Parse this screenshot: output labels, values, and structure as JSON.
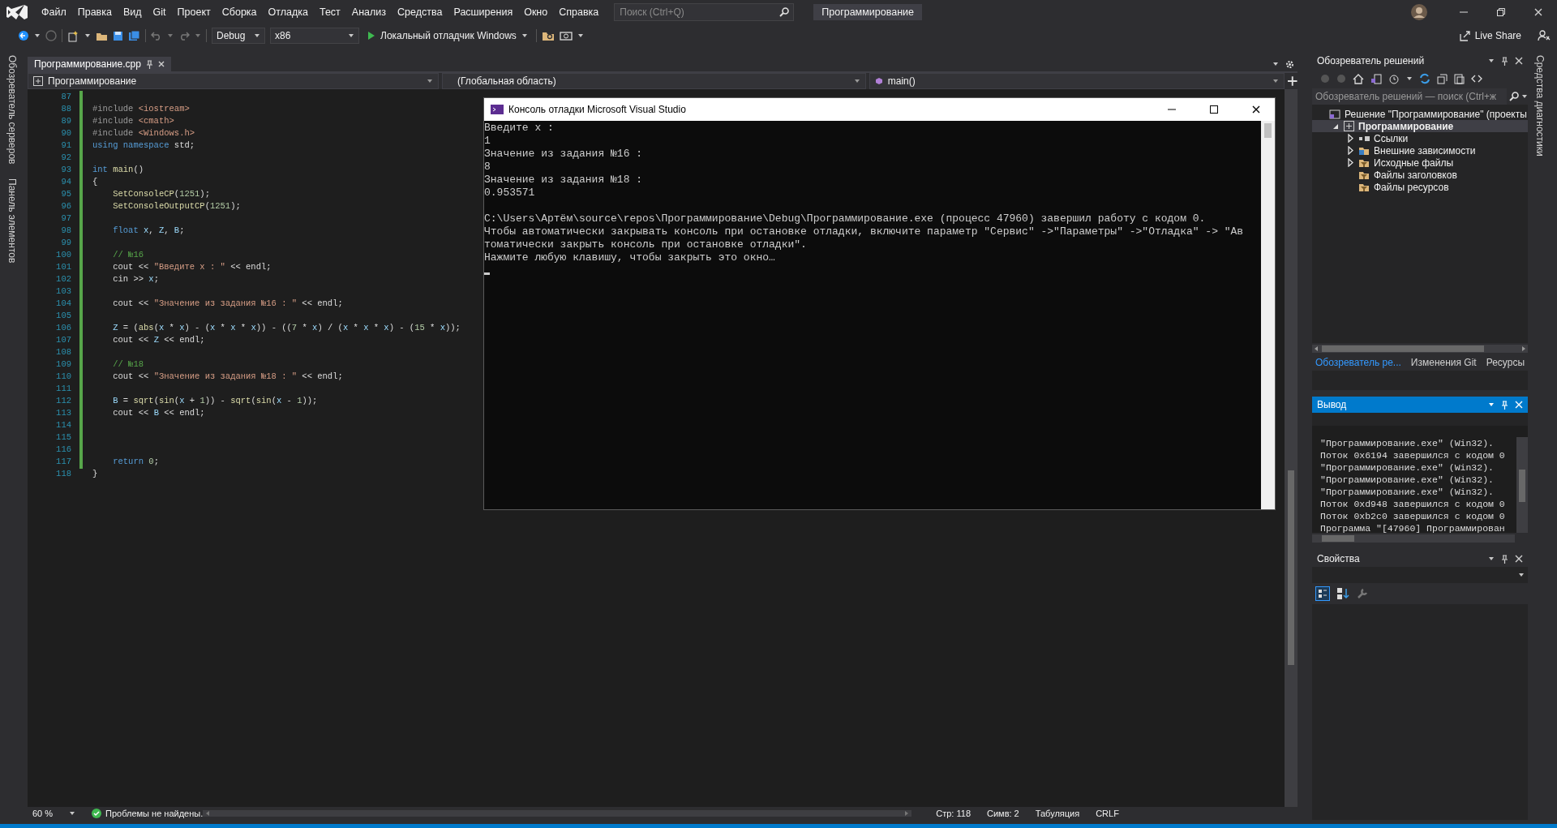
{
  "title_bar": {
    "menu": [
      "Файл",
      "Правка",
      "Вид",
      "Git",
      "Проект",
      "Сборка",
      "Отладка",
      "Тест",
      "Анализ",
      "Средства",
      "Расширения",
      "Окно",
      "Справка"
    ],
    "search": {
      "placeholder": "Поиск (Ctrl+Q)"
    },
    "solution_name": "Программирование"
  },
  "toolbar": {
    "configuration": "Debug",
    "platform": "x86",
    "run_button": "Локальный отладчик Windows",
    "live_share": "Live Share"
  },
  "left_tabs": [
    "Обозреватель серверов",
    "Панель элементов"
  ],
  "right_tabs": [
    "Средства диагностики"
  ],
  "editor": {
    "tabs": [
      {
        "label": "Программирование.cpp",
        "selected": true
      }
    ],
    "nav": [
      "Программирование",
      "(Глобальная область)",
      "main()"
    ],
    "lines": [
      {
        "number": "87"
      },
      {
        "number": "88",
        "tokens": [
          {
            "kind": "preproc",
            "text": "#include "
          },
          {
            "kind": "string",
            "text": "<iostream>"
          }
        ]
      },
      {
        "number": "89",
        "tokens": [
          {
            "kind": "preproc",
            "text": "#include "
          },
          {
            "kind": "string",
            "text": "<cmath>"
          }
        ]
      },
      {
        "number": "90",
        "tokens": [
          {
            "kind": "preproc",
            "text": "#include "
          },
          {
            "kind": "string",
            "text": "<Windows.h>"
          }
        ]
      },
      {
        "number": "91",
        "tokens": [
          {
            "kind": "keyword",
            "text": "using namespace "
          },
          {
            "kind": "plain",
            "text": "std;"
          }
        ]
      },
      {
        "number": "92"
      },
      {
        "number": "93",
        "tokens": [
          {
            "kind": "keyword",
            "text": "int "
          },
          {
            "kind": "func",
            "text": "main"
          },
          {
            "kind": "plain",
            "text": "()"
          }
        ]
      },
      {
        "number": "94",
        "tokens": [
          {
            "kind": "plain",
            "text": "{"
          }
        ]
      },
      {
        "number": "95",
        "tokens": [
          {
            "kind": "func",
            "text": "    SetConsoleCP"
          },
          {
            "kind": "plain",
            "text": "("
          },
          {
            "kind": "number",
            "text": "1251"
          },
          {
            "kind": "plain",
            "text": ");"
          }
        ]
      },
      {
        "number": "96",
        "tokens": [
          {
            "kind": "func",
            "text": "    SetConsoleOutputCP"
          },
          {
            "kind": "plain",
            "text": "("
          },
          {
            "kind": "number",
            "text": "1251"
          },
          {
            "kind": "plain",
            "text": ");"
          }
        ]
      },
      {
        "number": "97"
      },
      {
        "number": "98",
        "tokens": [
          {
            "kind": "keyword",
            "text": "    float "
          },
          {
            "kind": "var",
            "text": "x"
          },
          {
            "kind": "plain",
            "text": ", "
          },
          {
            "kind": "var",
            "text": "Z"
          },
          {
            "kind": "plain",
            "text": ", "
          },
          {
            "kind": "var",
            "text": "B"
          },
          {
            "kind": "plain",
            "text": ";"
          }
        ]
      },
      {
        "number": "99"
      },
      {
        "number": "100",
        "tokens": [
          {
            "kind": "comment",
            "text": "    // №16"
          }
        ]
      },
      {
        "number": "101",
        "tokens": [
          {
            "kind": "plain",
            "text": "    cout << "
          },
          {
            "kind": "string",
            "text": "\"Введите x : \""
          },
          {
            "kind": "plain",
            "text": " << endl;"
          }
        ]
      },
      {
        "number": "102",
        "tokens": [
          {
            "kind": "plain",
            "text": "    cin >> "
          },
          {
            "kind": "var",
            "text": "x"
          },
          {
            "kind": "plain",
            "text": ";"
          }
        ]
      },
      {
        "number": "103"
      },
      {
        "number": "104",
        "tokens": [
          {
            "kind": "plain",
            "text": "    cout << "
          },
          {
            "kind": "string",
            "text": "\"Значение из задания №16 : \""
          },
          {
            "kind": "plain",
            "text": " << endl;"
          }
        ]
      },
      {
        "number": "105"
      },
      {
        "number": "106",
        "tokens": [
          {
            "kind": "var",
            "text": "    Z"
          },
          {
            "kind": "plain",
            "text": " = ("
          },
          {
            "kind": "func",
            "text": "abs"
          },
          {
            "kind": "plain",
            "text": "("
          },
          {
            "kind": "var",
            "text": "x"
          },
          {
            "kind": "plain",
            "text": " * "
          },
          {
            "kind": "var",
            "text": "x"
          },
          {
            "kind": "plain",
            "text": ") - ("
          },
          {
            "kind": "var",
            "text": "x"
          },
          {
            "kind": "plain",
            "text": " * "
          },
          {
            "kind": "var",
            "text": "x"
          },
          {
            "kind": "plain",
            "text": " * "
          },
          {
            "kind": "var",
            "text": "x"
          },
          {
            "kind": "plain",
            "text": ")) - (("
          },
          {
            "kind": "number",
            "text": "7"
          },
          {
            "kind": "plain",
            "text": " * "
          },
          {
            "kind": "var",
            "text": "x"
          },
          {
            "kind": "plain",
            "text": ") / ("
          },
          {
            "kind": "var",
            "text": "x"
          },
          {
            "kind": "plain",
            "text": " * "
          },
          {
            "kind": "var",
            "text": "x"
          },
          {
            "kind": "plain",
            "text": " * "
          },
          {
            "kind": "var",
            "text": "x"
          },
          {
            "kind": "plain",
            "text": ") - ("
          },
          {
            "kind": "number",
            "text": "15"
          },
          {
            "kind": "plain",
            "text": " * "
          },
          {
            "kind": "var",
            "text": "x"
          },
          {
            "kind": "plain",
            "text": "));"
          }
        ]
      },
      {
        "number": "107",
        "tokens": [
          {
            "kind": "plain",
            "text": "    cout << "
          },
          {
            "kind": "var",
            "text": "Z"
          },
          {
            "kind": "plain",
            "text": " << endl;"
          }
        ]
      },
      {
        "number": "108"
      },
      {
        "number": "109",
        "tokens": [
          {
            "kind": "comment",
            "text": "    // №18"
          }
        ]
      },
      {
        "number": "110",
        "tokens": [
          {
            "kind": "plain",
            "text": "    cout << "
          },
          {
            "kind": "string",
            "text": "\"Значение из задания №18 : \""
          },
          {
            "kind": "plain",
            "text": " << endl;"
          }
        ]
      },
      {
        "number": "111"
      },
      {
        "number": "112",
        "tokens": [
          {
            "kind": "var",
            "text": "    B"
          },
          {
            "kind": "plain",
            "text": " = "
          },
          {
            "kind": "func",
            "text": "sqrt"
          },
          {
            "kind": "plain",
            "text": "("
          },
          {
            "kind": "func",
            "text": "sin"
          },
          {
            "kind": "plain",
            "text": "("
          },
          {
            "kind": "var",
            "text": "x"
          },
          {
            "kind": "plain",
            "text": " + "
          },
          {
            "kind": "number",
            "text": "1"
          },
          {
            "kind": "plain",
            "text": ")) - "
          },
          {
            "kind": "func",
            "text": "sqrt"
          },
          {
            "kind": "plain",
            "text": "("
          },
          {
            "kind": "func",
            "text": "sin"
          },
          {
            "kind": "plain",
            "text": "("
          },
          {
            "kind": "var",
            "text": "x"
          },
          {
            "kind": "plain",
            "text": " - "
          },
          {
            "kind": "number",
            "text": "1"
          },
          {
            "kind": "plain",
            "text": "));"
          }
        ]
      },
      {
        "number": "113",
        "tokens": [
          {
            "kind": "plain",
            "text": "    cout << "
          },
          {
            "kind": "var",
            "text": "B"
          },
          {
            "kind": "plain",
            "text": " << endl;"
          }
        ]
      },
      {
        "number": "114"
      },
      {
        "number": "115"
      },
      {
        "number": "116"
      },
      {
        "number": "117",
        "tokens": [
          {
            "kind": "keyword",
            "text": "    return "
          },
          {
            "kind": "number",
            "text": "0"
          },
          {
            "kind": "plain",
            "text": ";"
          }
        ]
      },
      {
        "number": "118",
        "tokens": [
          {
            "kind": "plain",
            "text": "}"
          }
        ]
      }
    ]
  },
  "console": {
    "title": "Консоль отладки Microsoft Visual Studio",
    "program_output": [
      "Введите x :",
      "1",
      "Значение из задания №16 :",
      "8",
      "Значение из задания №18 :",
      "0.953571"
    ],
    "messages": [
      "C:\\Users\\Артём\\source\\repos\\Программирование\\Debug\\Программирование.exe (процесс 47960) завершил работу с кодом 0.",
      "Чтобы автоматически закрывать консоль при остановке отладки, включите параметр \"Сервис\" ->\"Параметры\" ->\"Отладка\" -> \"Ав",
      "томатически закрыть консоль при остановке отладки\".",
      "Нажмите любую клавишу, чтобы закрыть это окно…"
    ]
  },
  "solution_explorer": {
    "title": "Обозреватель решений",
    "search": {
      "placeholder": "Обозреватель решений — поиск (Ctrl+ж"
    },
    "tree": [
      {
        "label": "Решение \"Программирование\" (проекты",
        "kind": "solution",
        "selected": false,
        "children": [
          {
            "label": "Программирование",
            "kind": "project",
            "expanded": true,
            "selected": true,
            "children": [
              {
                "label": "Ссылки",
                "kind": "references",
                "expanded": false,
                "selected": false
              },
              {
                "label": "Внешние зависимости",
                "kind": "external",
                "expanded": false,
                "selected": false
              },
              {
                "label": "Исходные файлы",
                "kind": "filter",
                "expanded": false,
                "selected": false
              },
              {
                "label": "Файлы заголовков",
                "kind": "filter",
                "selected": false
              },
              {
                "label": "Файлы ресурсов",
                "kind": "filter",
                "selected": false
              }
            ]
          }
        ]
      }
    ],
    "tabs": [
      {
        "label": "Обозреватель ре...",
        "selected": true
      },
      {
        "label": "Изменения Git",
        "selected": false
      },
      {
        "label": "Ресурсы",
        "selected": false
      }
    ]
  },
  "output": {
    "title": "Вывод",
    "lines": [
      "\"Программирование.exe\" (Win32).",
      "Поток 0x6194 завершился с кодом 0",
      "\"Программирование.exe\" (Win32).",
      "\"Программирование.exe\" (Win32).",
      "\"Программирование.exe\" (Win32).",
      "Поток 0xd948 завершился с кодом 0",
      "Поток 0xb2c0 завершился с кодом 0",
      "Программа \"[47960] Программирован"
    ]
  },
  "properties": {
    "title": "Свойства"
  },
  "status_bar": {
    "zoom": "60 %",
    "problems": "Проблемы не найдены.",
    "line": "Стр: 118",
    "column": "Симв: 2",
    "indent": "Табуляция",
    "line_ending": "CRLF"
  }
}
